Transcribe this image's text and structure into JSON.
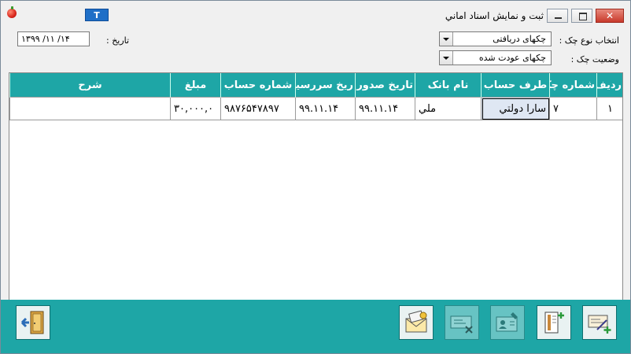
{
  "window": {
    "title": "ثبت و نمایش اسناد اماني",
    "t_button": "T"
  },
  "filters": {
    "date_label": "تاریخ :",
    "date_value": "۱۳۹۹ /۱۱ /۱۴",
    "check_type_label": "انتخاب نوع چک :",
    "check_type_value": "چکهای دریافتی",
    "check_status_label": "وضعیت چک :",
    "check_status_value": "چکهای عودت شده"
  },
  "table": {
    "columns": [
      "ردیف",
      "شماره چک",
      "طرف حساب",
      "نام بانک",
      "تاریخ صدور",
      "ریخ سررسید",
      "شماره حساب",
      "مبلغ",
      "شرح"
    ],
    "rows": [
      [
        "۱",
        "۷",
        "سارا دولتي",
        "ملي",
        "۹۹.۱۱.۱۴",
        "۹۹.۱۱.۱۴",
        "۹۸۷۶۵۴۷۸۹۷",
        "۳۰,۰۰۰,۰",
        ""
      ]
    ]
  },
  "toolbar": {
    "buttons": [
      {
        "icon": "exit-door-icon",
        "enabled": true
      },
      {
        "icon": "envelope-check-icon",
        "enabled": true
      },
      {
        "icon": "cancel-check-icon",
        "enabled": false
      },
      {
        "icon": "person-card-icon",
        "enabled": false
      },
      {
        "icon": "document-add-icon",
        "enabled": true
      },
      {
        "icon": "new-check-icon",
        "enabled": true
      }
    ]
  },
  "colors": {
    "accent": "#1ea6a6",
    "title_button": "#1f6fc7"
  }
}
